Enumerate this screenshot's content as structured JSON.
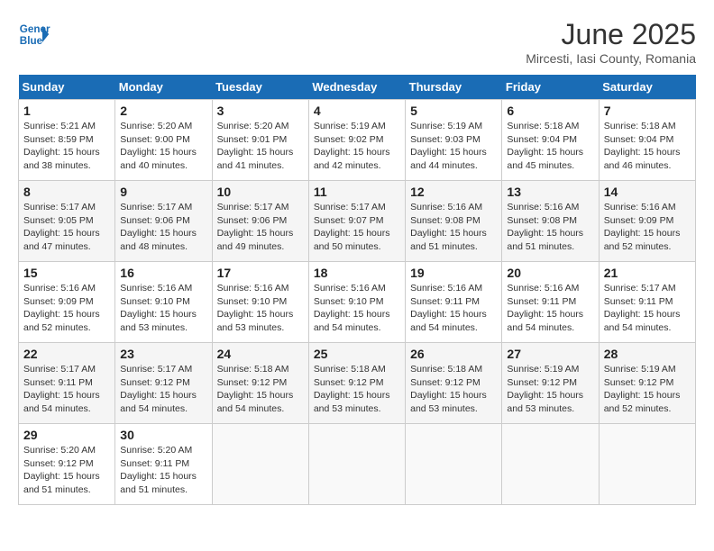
{
  "header": {
    "logo_line1": "General",
    "logo_line2": "Blue",
    "month_title": "June 2025",
    "location": "Mircesti, Iasi County, Romania"
  },
  "days_of_week": [
    "Sunday",
    "Monday",
    "Tuesday",
    "Wednesday",
    "Thursday",
    "Friday",
    "Saturday"
  ],
  "weeks": [
    [
      {
        "num": "1",
        "sunrise": "5:21 AM",
        "sunset": "8:59 PM",
        "daylight": "15 hours and 38 minutes."
      },
      {
        "num": "2",
        "sunrise": "5:20 AM",
        "sunset": "9:00 PM",
        "daylight": "15 hours and 40 minutes."
      },
      {
        "num": "3",
        "sunrise": "5:20 AM",
        "sunset": "9:01 PM",
        "daylight": "15 hours and 41 minutes."
      },
      {
        "num": "4",
        "sunrise": "5:19 AM",
        "sunset": "9:02 PM",
        "daylight": "15 hours and 42 minutes."
      },
      {
        "num": "5",
        "sunrise": "5:19 AM",
        "sunset": "9:03 PM",
        "daylight": "15 hours and 44 minutes."
      },
      {
        "num": "6",
        "sunrise": "5:18 AM",
        "sunset": "9:04 PM",
        "daylight": "15 hours and 45 minutes."
      },
      {
        "num": "7",
        "sunrise": "5:18 AM",
        "sunset": "9:04 PM",
        "daylight": "15 hours and 46 minutes."
      }
    ],
    [
      {
        "num": "8",
        "sunrise": "5:17 AM",
        "sunset": "9:05 PM",
        "daylight": "15 hours and 47 minutes."
      },
      {
        "num": "9",
        "sunrise": "5:17 AM",
        "sunset": "9:06 PM",
        "daylight": "15 hours and 48 minutes."
      },
      {
        "num": "10",
        "sunrise": "5:17 AM",
        "sunset": "9:06 PM",
        "daylight": "15 hours and 49 minutes."
      },
      {
        "num": "11",
        "sunrise": "5:17 AM",
        "sunset": "9:07 PM",
        "daylight": "15 hours and 50 minutes."
      },
      {
        "num": "12",
        "sunrise": "5:16 AM",
        "sunset": "9:08 PM",
        "daylight": "15 hours and 51 minutes."
      },
      {
        "num": "13",
        "sunrise": "5:16 AM",
        "sunset": "9:08 PM",
        "daylight": "15 hours and 51 minutes."
      },
      {
        "num": "14",
        "sunrise": "5:16 AM",
        "sunset": "9:09 PM",
        "daylight": "15 hours and 52 minutes."
      }
    ],
    [
      {
        "num": "15",
        "sunrise": "5:16 AM",
        "sunset": "9:09 PM",
        "daylight": "15 hours and 52 minutes."
      },
      {
        "num": "16",
        "sunrise": "5:16 AM",
        "sunset": "9:10 PM",
        "daylight": "15 hours and 53 minutes."
      },
      {
        "num": "17",
        "sunrise": "5:16 AM",
        "sunset": "9:10 PM",
        "daylight": "15 hours and 53 minutes."
      },
      {
        "num": "18",
        "sunrise": "5:16 AM",
        "sunset": "9:10 PM",
        "daylight": "15 hours and 54 minutes."
      },
      {
        "num": "19",
        "sunrise": "5:16 AM",
        "sunset": "9:11 PM",
        "daylight": "15 hours and 54 minutes."
      },
      {
        "num": "20",
        "sunrise": "5:16 AM",
        "sunset": "9:11 PM",
        "daylight": "15 hours and 54 minutes."
      },
      {
        "num": "21",
        "sunrise": "5:17 AM",
        "sunset": "9:11 PM",
        "daylight": "15 hours and 54 minutes."
      }
    ],
    [
      {
        "num": "22",
        "sunrise": "5:17 AM",
        "sunset": "9:11 PM",
        "daylight": "15 hours and 54 minutes."
      },
      {
        "num": "23",
        "sunrise": "5:17 AM",
        "sunset": "9:12 PM",
        "daylight": "15 hours and 54 minutes."
      },
      {
        "num": "24",
        "sunrise": "5:18 AM",
        "sunset": "9:12 PM",
        "daylight": "15 hours and 54 minutes."
      },
      {
        "num": "25",
        "sunrise": "5:18 AM",
        "sunset": "9:12 PM",
        "daylight": "15 hours and 53 minutes."
      },
      {
        "num": "26",
        "sunrise": "5:18 AM",
        "sunset": "9:12 PM",
        "daylight": "15 hours and 53 minutes."
      },
      {
        "num": "27",
        "sunrise": "5:19 AM",
        "sunset": "9:12 PM",
        "daylight": "15 hours and 53 minutes."
      },
      {
        "num": "28",
        "sunrise": "5:19 AM",
        "sunset": "9:12 PM",
        "daylight": "15 hours and 52 minutes."
      }
    ],
    [
      {
        "num": "29",
        "sunrise": "5:20 AM",
        "sunset": "9:12 PM",
        "daylight": "15 hours and 51 minutes."
      },
      {
        "num": "30",
        "sunrise": "5:20 AM",
        "sunset": "9:11 PM",
        "daylight": "15 hours and 51 minutes."
      },
      null,
      null,
      null,
      null,
      null
    ]
  ]
}
